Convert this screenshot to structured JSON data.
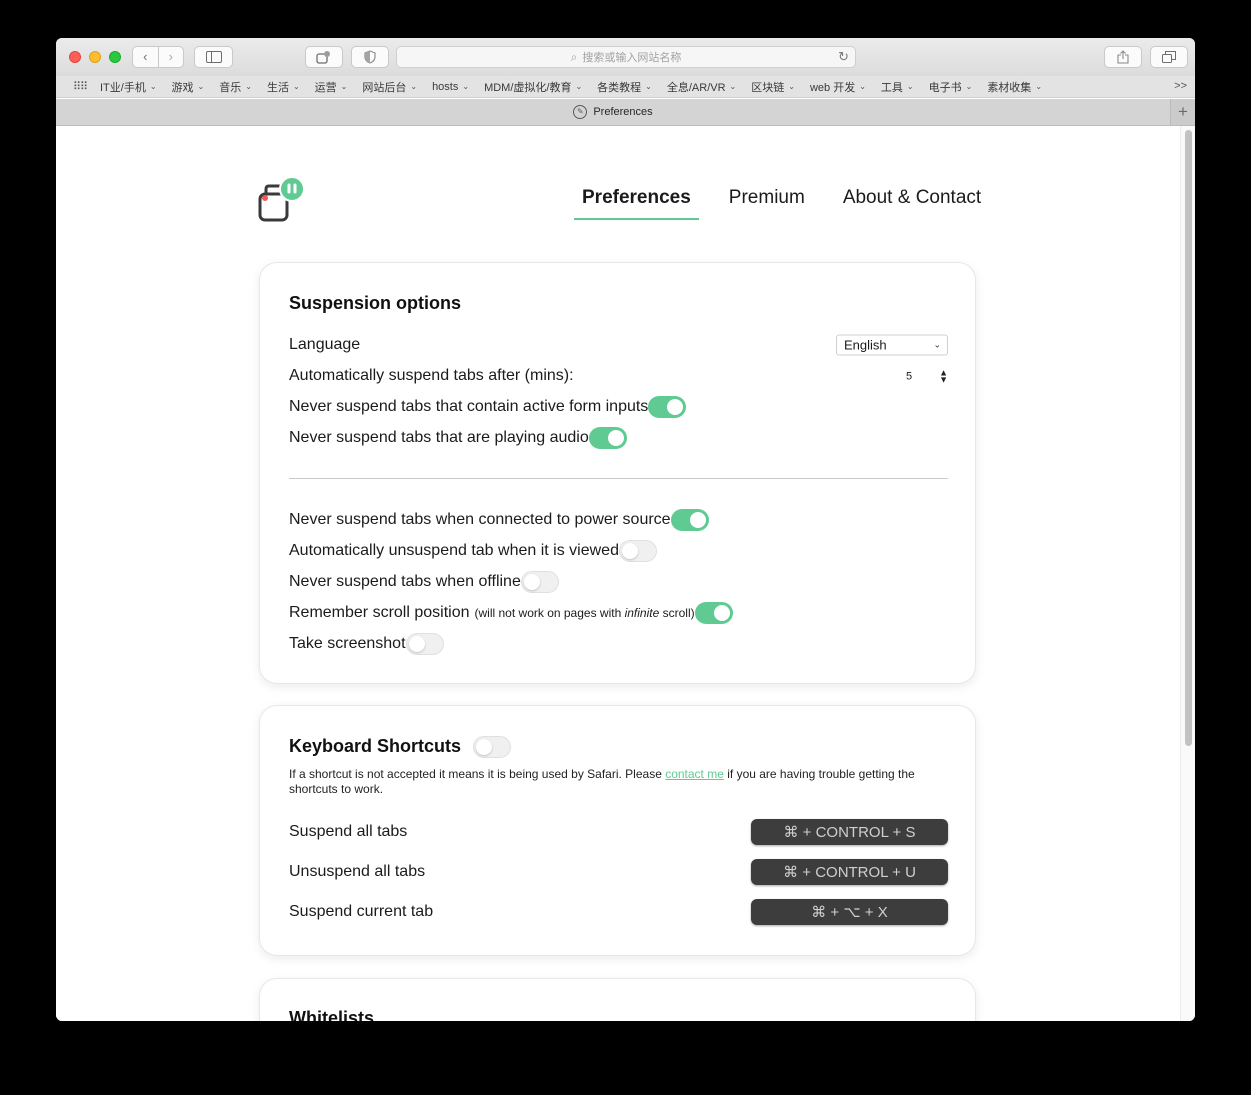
{
  "browser": {
    "url_placeholder": "搜索或输入网站名称",
    "tab_title": "Preferences",
    "bookmarks": [
      "IT业/手机",
      "游戏",
      "音乐",
      "生活",
      "运营",
      "网站后台",
      "hosts",
      "MDM/虚拟化/教育",
      "各类教程",
      "全息/AR/VR",
      "区块链",
      "web 开发",
      "工具",
      "电子书",
      "素材收集"
    ],
    "more_glyph": ">>",
    "newtab_glyph": "+"
  },
  "nav": {
    "preferences": "Preferences",
    "premium": "Premium",
    "about": "About & Contact"
  },
  "suspension": {
    "title": "Suspension options",
    "language_label": "Language",
    "language_value": "English",
    "auto_suspend_label": "Automatically suspend tabs after (mins):",
    "auto_suspend_value": "5",
    "form_inputs_label": "Never suspend tabs that contain active form inputs",
    "form_inputs_on": true,
    "audio_label": "Never suspend tabs that are playing audio",
    "audio_on": true,
    "power_label": "Never suspend tabs when connected to power source",
    "power_on": true,
    "unsuspend_viewed_label": "Automatically unsuspend tab when it is viewed",
    "unsuspend_viewed_on": false,
    "offline_label": "Never suspend tabs when offline",
    "offline_on": false,
    "scroll_label": "Remember scroll position",
    "scroll_note_pre": "(will not work on pages with ",
    "scroll_note_em": "infinite",
    "scroll_note_post": " scroll)",
    "scroll_on": true,
    "screenshot_label": "Take screenshot",
    "screenshot_on": false
  },
  "keyboard": {
    "title": "Keyboard Shortcuts",
    "enabled": false,
    "desc_pre": "If a shortcut is not accepted it means it is being used by Safari. Please ",
    "desc_link": "contact me",
    "desc_post": " if you are having trouble getting the shortcuts to work.",
    "suspend_all_label": "Suspend all tabs",
    "suspend_all_keys": "⌘ + CONTROL + S",
    "unsuspend_all_label": "Unsuspend all tabs",
    "unsuspend_all_keys": "⌘ + CONTROL + U",
    "suspend_current_label": "Suspend current tab",
    "suspend_current_keys": "⌘ + ⌥ + X"
  },
  "whitelists": {
    "title": "Whitelists"
  },
  "colors": {
    "accent": "#5fcb93",
    "kbd_bg": "#3d3d3d"
  }
}
